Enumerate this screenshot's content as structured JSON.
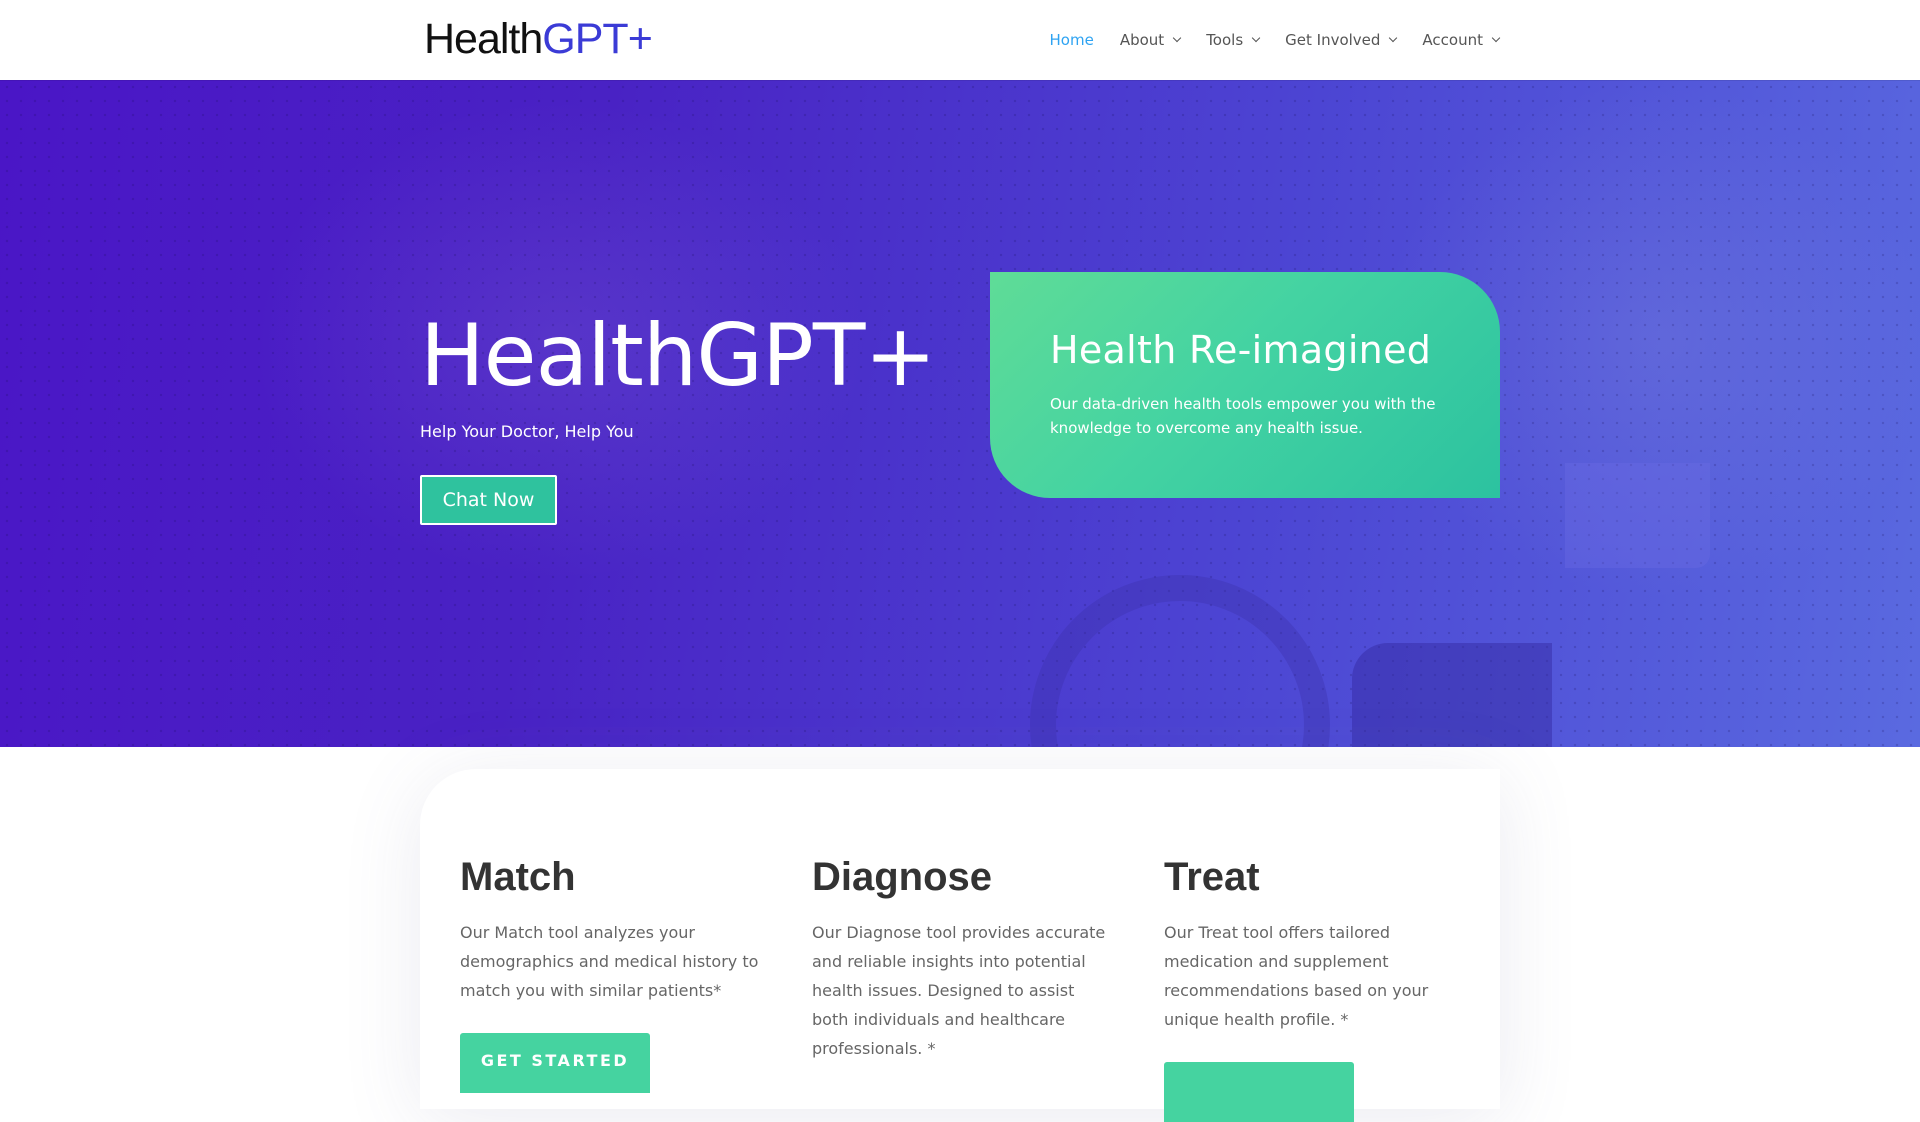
{
  "header": {
    "logo": {
      "part_a": "Health",
      "part_b": "GPT+"
    },
    "nav": [
      {
        "label": "Home",
        "active": true,
        "has_dropdown": false
      },
      {
        "label": "About",
        "active": false,
        "has_dropdown": true
      },
      {
        "label": "Tools",
        "active": false,
        "has_dropdown": true
      },
      {
        "label": "Get Involved",
        "active": false,
        "has_dropdown": true
      },
      {
        "label": "Account",
        "active": false,
        "has_dropdown": true
      }
    ]
  },
  "hero": {
    "title": "HealthGPT+",
    "subtitle": "Help Your Doctor, Help You",
    "cta_label": "Chat Now",
    "card": {
      "title": "Health Re-imagined",
      "text": "Our data-driven health tools empower you with the knowledge to overcome any health issue."
    }
  },
  "tools": [
    {
      "title": "Match",
      "text": "Our Match tool analyzes your demographics and medical history to match you with similar patients*",
      "button": "GET STARTED"
    },
    {
      "title": "Diagnose",
      "text": "Our Diagnose tool provides accurate and reliable insights into potential health issues. Designed to assist both individuals and healthcare professionals. *",
      "button": ""
    },
    {
      "title": "Treat",
      "text": "Our Treat tool offers tailored medication and supplement recommendations based on your unique health profile. *",
      "button": ""
    }
  ],
  "colors": {
    "accent_link": "#2ea3f2",
    "brand_blue": "#3b3bd6",
    "hero_purple": "#4a16c6",
    "teal": "#45d3a0"
  }
}
